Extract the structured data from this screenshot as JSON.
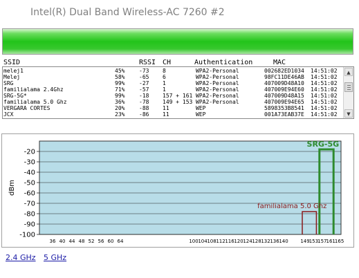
{
  "window": {
    "title": "Intel(R) Dual Band Wireless-AC 7260 #2"
  },
  "signal": {
    "level_fraction": 1.0,
    "color": "#22c41a"
  },
  "table": {
    "headers": {
      "ssid": "SSID",
      "signal": "",
      "rssi": "RSSI",
      "ch": "CH",
      "auth": "Authentication",
      "mac": "MAC"
    },
    "rows": [
      {
        "ssid": "melej1",
        "signal": "45%",
        "rssi": "-73",
        "ch": "8",
        "auth": "WPA2-Personal",
        "mac": "002682ED1034",
        "time": "14:51:02"
      },
      {
        "ssid": "Melej",
        "signal": "58%",
        "rssi": "-65",
        "ch": "6",
        "auth": "WPA2-Personal",
        "mac": "98FC11DE46AB",
        "time": "14:51:02"
      },
      {
        "ssid": "SRG",
        "signal": "99%",
        "rssi": "-27",
        "ch": "1",
        "auth": "WPA2-Personal",
        "mac": "407009D48A10",
        "time": "14:51:02"
      },
      {
        "ssid": "familialama 2.4Ghz",
        "signal": "71%",
        "rssi": "-57",
        "ch": "1",
        "auth": "WPA2-Personal",
        "mac": "407009E94E60",
        "time": "14:51:02"
      },
      {
        "ssid": "SRG-5G*",
        "signal": "99%",
        "rssi": "-18",
        "ch": "157 + 161",
        "auth": "WPA2-Personal",
        "mac": "407009D48A15",
        "time": "14:51:02"
      },
      {
        "ssid": "familialama 5.0 Ghz",
        "signal": "36%",
        "rssi": "-78",
        "ch": "149 + 153",
        "auth": "WPA2-Personal",
        "mac": "407009E94E65",
        "time": "14:51:02"
      },
      {
        "ssid": "VERGARA CORTES",
        "signal": "20%",
        "rssi": "-88",
        "ch": "11",
        "auth": "WEP",
        "mac": "5898353B8541",
        "time": "14:51:02"
      },
      {
        "ssid": "JCX",
        "signal": "23%",
        "rssi": "-86",
        "ch": "11",
        "auth": "WEP",
        "mac": "001A73EAB37E",
        "time": "14:51:02"
      }
    ]
  },
  "scrollbar": {
    "up_glyph": "▲",
    "down_glyph": "▼"
  },
  "chart_data": {
    "type": "line",
    "title": "",
    "ylabel": "dBm",
    "xlabel": "",
    "ylim": [
      -100,
      -10
    ],
    "yticks": [
      -20,
      -30,
      -40,
      -50,
      -60,
      -70,
      -80,
      -90,
      -100
    ],
    "xticks": [
      "36",
      "40",
      "44",
      "48",
      "52",
      "56",
      "60",
      "64",
      "100",
      "104",
      "108",
      "112",
      "116",
      "120",
      "124",
      "128",
      "132",
      "136",
      "140",
      "149",
      "153",
      "157",
      "161",
      "165"
    ],
    "background": "#b8dde8",
    "grid": true,
    "series": [
      {
        "name": "SRG-5G",
        "channels": [
          "157",
          "161"
        ],
        "rssi": -18,
        "color": "#2e8b2e",
        "line_width": 3,
        "label_color": "#2e8b2e"
      },
      {
        "name": "familialama 5.0 Ghz",
        "channels": [
          "149",
          "153"
        ],
        "rssi": -78,
        "color": "#8b1a1a",
        "line_width": 1.5,
        "label_color": "#8b1a1a"
      }
    ]
  },
  "links": {
    "band_24": "2.4 GHz",
    "band_5": "5 GHz"
  }
}
